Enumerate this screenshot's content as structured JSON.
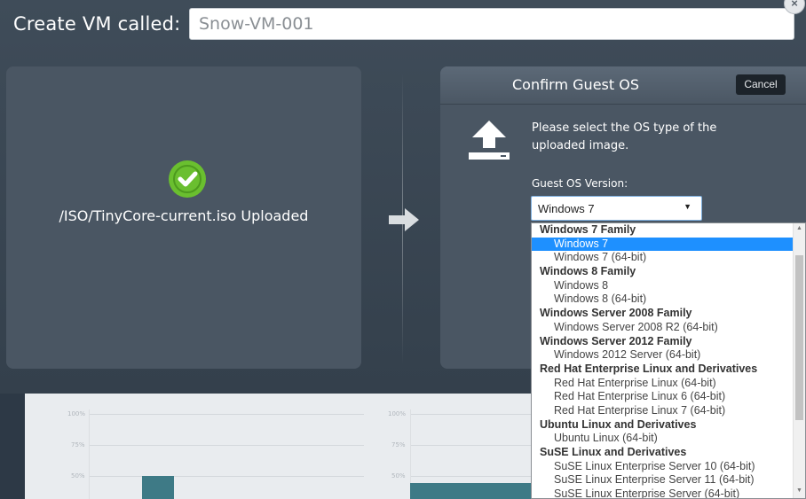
{
  "header": {
    "label": "Create VM called:",
    "vm_name_value": "Snow-VM-001"
  },
  "left_panel": {
    "upload_status": "/ISO/TinyCore-current.iso Uploaded"
  },
  "confirm_panel": {
    "title": "Confirm Guest OS",
    "cancel_label": "Cancel",
    "instruction": "Please select the OS type of the uploaded image.",
    "guest_os_label": "Guest OS Version:",
    "selected_value": "Windows 7"
  },
  "dropdown": {
    "rows": [
      {
        "type": "group",
        "label": "Windows 7 Family"
      },
      {
        "type": "option",
        "label": "Windows 7",
        "selected": true
      },
      {
        "type": "option",
        "label": "Windows 7 (64-bit)"
      },
      {
        "type": "group",
        "label": "Windows 8 Family"
      },
      {
        "type": "option",
        "label": "Windows 8"
      },
      {
        "type": "option",
        "label": "Windows 8 (64-bit)"
      },
      {
        "type": "group",
        "label": "Windows Server 2008 Family"
      },
      {
        "type": "option",
        "label": "Windows Server 2008 R2 (64-bit)"
      },
      {
        "type": "group",
        "label": "Windows Server 2012 Family"
      },
      {
        "type": "option",
        "label": "Windows 2012 Server (64-bit)"
      },
      {
        "type": "group",
        "label": "Red Hat Enterprise Linux and Derivatives"
      },
      {
        "type": "option",
        "label": "Red Hat Enterprise Linux (64-bit)"
      },
      {
        "type": "option",
        "label": "Red Hat Enterprise Linux 6 (64-bit)"
      },
      {
        "type": "option",
        "label": "Red Hat Enterprise Linux 7 (64-bit)"
      },
      {
        "type": "group",
        "label": "Ubuntu Linux and Derivatives"
      },
      {
        "type": "option",
        "label": "Ubuntu Linux (64-bit)"
      },
      {
        "type": "group",
        "label": "SuSE Linux and Derivatives"
      },
      {
        "type": "option",
        "label": "SuSE Linux Enterprise Server 10 (64-bit)"
      },
      {
        "type": "option",
        "label": "SuSE Linux Enterprise Server 11 (64-bit)"
      },
      {
        "type": "option",
        "label": "SuSE Linux Enterprise Server (64-bit)"
      }
    ]
  },
  "background": {
    "left_y_ticks": [
      "100%",
      "75%",
      "50%"
    ],
    "right_y_ticks": [
      "100%",
      "75%",
      "50%"
    ]
  },
  "colors": {
    "success_green": "#6abf2f",
    "selection_blue": "#1e90ff",
    "panel_bg": "#4a5663",
    "modal_bg": "#3a4653"
  }
}
